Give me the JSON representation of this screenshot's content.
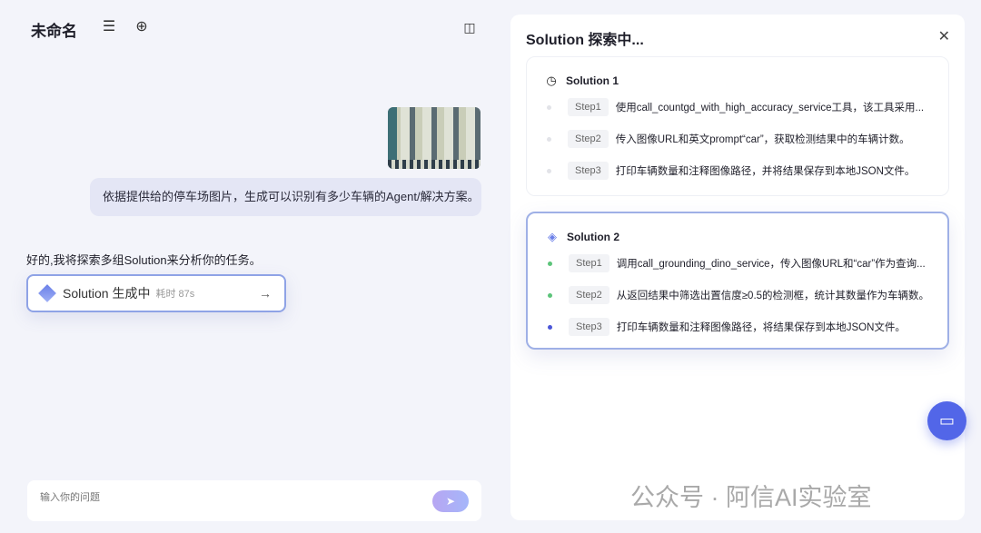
{
  "header": {
    "title": "未命名",
    "icons": [
      "menu-icon",
      "add-circle-icon",
      "sidebar-toggle-icon"
    ]
  },
  "chat": {
    "user_message": "依据提供给的停车场图片，生成可以识别有多少车辆的Agent/解决方案。",
    "assistant_message": "好的,我将探索多组Solution来分析你的任务。",
    "solution_button": {
      "label": "Solution 生成中",
      "time": "耗时 87s",
      "arrow": "→"
    },
    "input_placeholder": "输入你的问题"
  },
  "panel": {
    "title": "Solution 探索中...",
    "solutions": [
      {
        "title": "Solution 1",
        "icon": "clock-icon",
        "steps": [
          {
            "tag": "Step1",
            "text": "使用call_countgd_with_high_accuracy_service工具，该工具采用...",
            "status": "pending"
          },
          {
            "tag": "Step2",
            "text": "传入图像URL和英文prompt“car”，获取检测结果中的车辆计数。",
            "status": "pending"
          },
          {
            "tag": "Step3",
            "text": "打印车辆数量和注释图像路径，并将结果保存到本地JSON文件。",
            "status": "pending"
          }
        ]
      },
      {
        "title": "Solution 2",
        "icon": "cube-icon",
        "steps": [
          {
            "tag": "Step1",
            "text": "调用call_grounding_dino_service，传入图像URL和“car”作为查询...",
            "status": "done"
          },
          {
            "tag": "Step2",
            "text": "从返回结果中筛选出置信度≥0.5的检测框，统计其数量作为车辆数。",
            "status": "done"
          },
          {
            "tag": "Step3",
            "text": "打印车辆数量和注释图像路径，将结果保存到本地JSON文件。",
            "status": "active"
          }
        ]
      }
    ]
  },
  "watermark": "公众号 · 阿信AI实验室",
  "colors": {
    "accent": "#5266e8",
    "done": "#5cc47a",
    "active": "#4b56d8",
    "pending": "#e2e3e8"
  }
}
